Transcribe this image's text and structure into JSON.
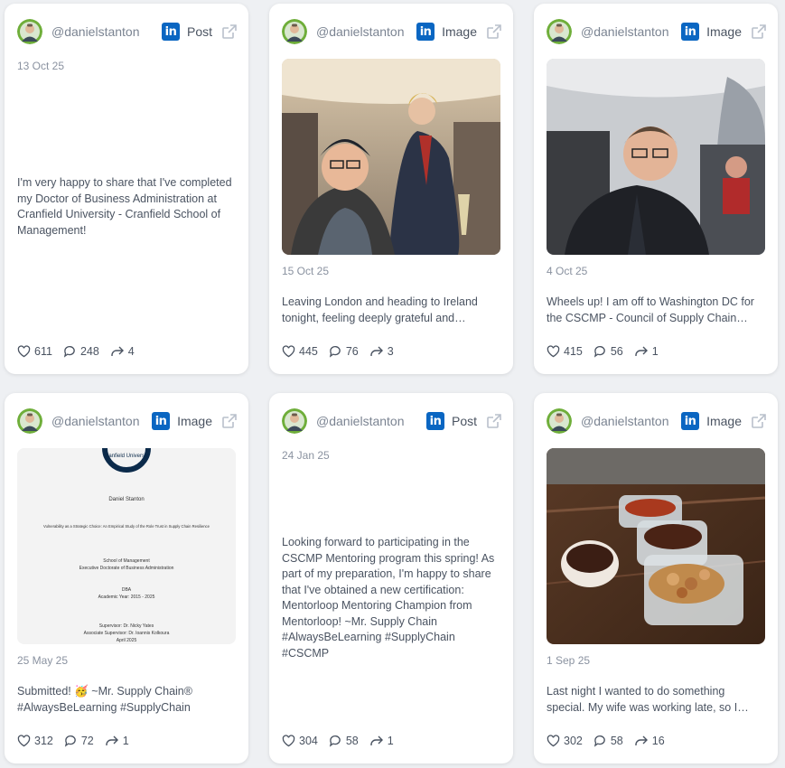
{
  "cards": [
    {
      "handle": "@danielstanton",
      "type": "Post",
      "date": "13 Oct 25",
      "text": "I'm very happy to share that I've completed my Doctor of Business Administration at Cranfield University - Cranfield School of Management!",
      "likes": "611",
      "comments": "248",
      "shares": "4"
    },
    {
      "handle": "@danielstanton",
      "type": "Image",
      "date": "15 Oct 25",
      "text": "Leaving London and heading to Ireland tonight, feeling deeply grateful and humbled.",
      "likes": "445",
      "comments": "76",
      "shares": "3"
    },
    {
      "handle": "@danielstanton",
      "type": "Image",
      "date": "4 Oct 25",
      "text": "Wheels up! I am off to Washington DC for the CSCMP - Council of Supply Chain Management Professionals EDGE conference.",
      "likes": "415",
      "comments": "56",
      "shares": "1"
    },
    {
      "handle": "@danielstanton",
      "type": "Image",
      "date": "25 May 25",
      "text": "Submitted! 🥳 ~Mr. Supply Chain® #AlwaysBeLearning #SupplyChain",
      "likes": "312",
      "comments": "72",
      "shares": "1",
      "doc": {
        "university": "Cranfield University",
        "author": "Daniel Stanton",
        "title": "Vulnerability as a Strategic Choice: An Empirical Study of the Role Trust in Supply Chain Resilience",
        "school": "School of Management",
        "programme": "Executive Doctorate of Business Administration",
        "degree": "DBA",
        "year": "Academic Year: 2015 - 2025",
        "supervisor": "Supervisor: Dr. Nicky Yates",
        "assoc": "Associate Supervisor: Dr. Ioannis Kolkoura",
        "date": "April 2025"
      }
    },
    {
      "handle": "@danielstanton",
      "type": "Post",
      "date": "24 Jan 25",
      "text": "Looking forward to participating in the CSCMP Mentoring program this spring! As part of my preparation, I'm happy to share that I've obtained a new certification: Mentorloop Mentoring Champion from Mentorloop! ~Mr. Supply Chain #AlwaysBeLearning #SupplyChain #CSCMP",
      "likes": "304",
      "comments": "58",
      "shares": "1"
    },
    {
      "handle": "@danielstanton",
      "type": "Image",
      "date": "1 Sep 25",
      "text": "Last night I wanted to do something special. My wife was working late, so I cooked dinner.",
      "likes": "302",
      "comments": "58",
      "shares": "16"
    }
  ],
  "icons": {
    "network": "linkedin-icon",
    "open": "external-link-icon",
    "like": "heart-icon",
    "comment": "comment-icon",
    "share": "share-icon"
  },
  "colors": {
    "linkedin": "#0a66c2",
    "text": "#4a5361",
    "muted": "#8a92a0",
    "background": "#eef0f3"
  }
}
